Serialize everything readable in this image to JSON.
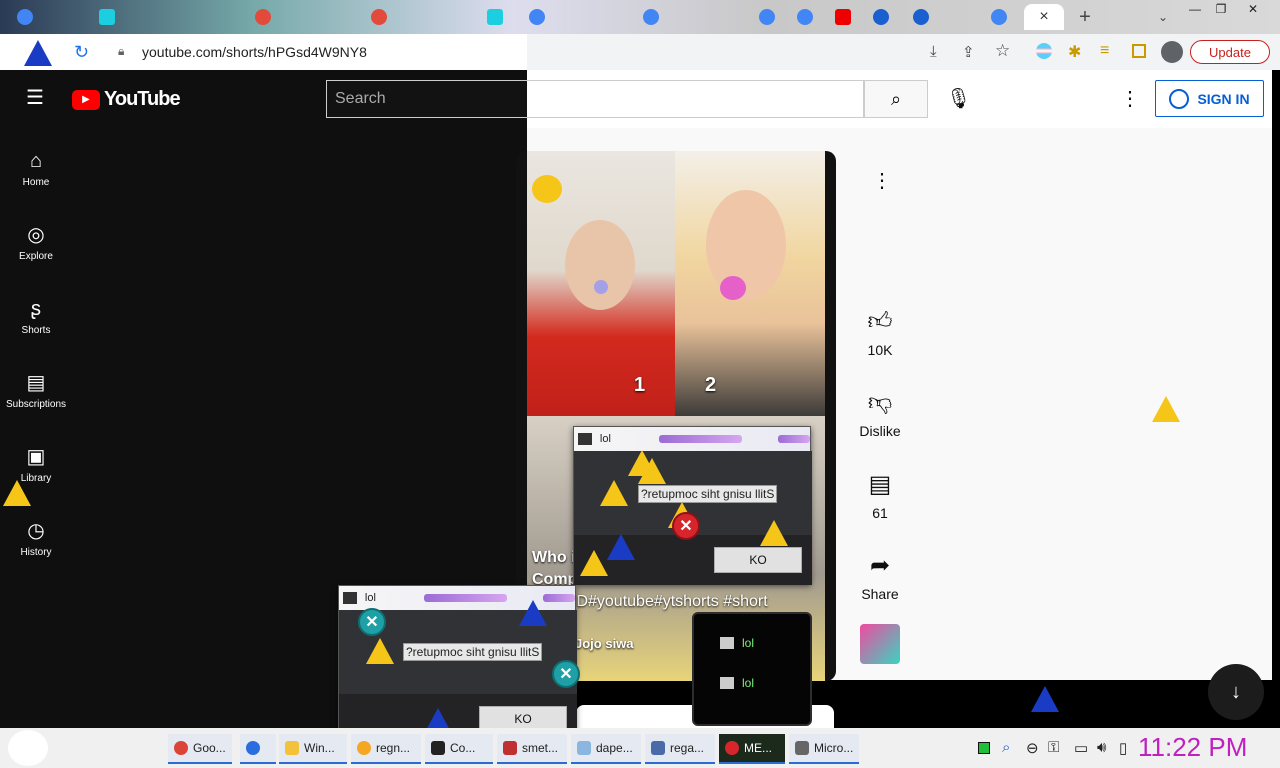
{
  "browser": {
    "url": "youtube.com/shorts/hPGsd4W9NY8",
    "update_label": "Update",
    "new_tab": "+",
    "close_tab": "×",
    "minimize": "—",
    "restore": "❐",
    "close_window": "✕"
  },
  "youtube": {
    "logo_text": "YouTube",
    "search_placeholder": "Search",
    "sign_in": "SIGN IN",
    "sidebar": [
      {
        "label": "Home",
        "icon": "⌂"
      },
      {
        "label": "Explore",
        "icon": "◎"
      },
      {
        "label": "Shorts",
        "icon": "ʂ"
      },
      {
        "label": "Subscriptions",
        "icon": "▤"
      },
      {
        "label": "Library",
        "icon": "▣"
      },
      {
        "label": "History",
        "icon": "◷"
      }
    ]
  },
  "short": {
    "title_partial": "Who i",
    "title_line2": "Comp",
    "hashtags": ".D#youtube#ytshorts #short",
    "channel": "Jojo siwa",
    "number1": "1",
    "number2": "2",
    "more": "⋮",
    "likes": "10K",
    "dislike": "Dislike",
    "comments": "61",
    "share": "Share"
  },
  "popups": [
    {
      "title": "lol",
      "message": "?retupmoc siht gnisu llitS",
      "button": "KO"
    },
    {
      "title": "lol",
      "message": "?retupmoc siht gnisu llitS",
      "button": "KO"
    }
  ],
  "black_menu": {
    "items": [
      "lol",
      "lol"
    ]
  },
  "taskbar": {
    "items": [
      "Goo...",
      "",
      "Win...",
      "regn...",
      "Co...",
      "smet...",
      "dape...",
      "rega...",
      "ME...",
      "Micro..."
    ],
    "clock": "11:22 PM"
  }
}
